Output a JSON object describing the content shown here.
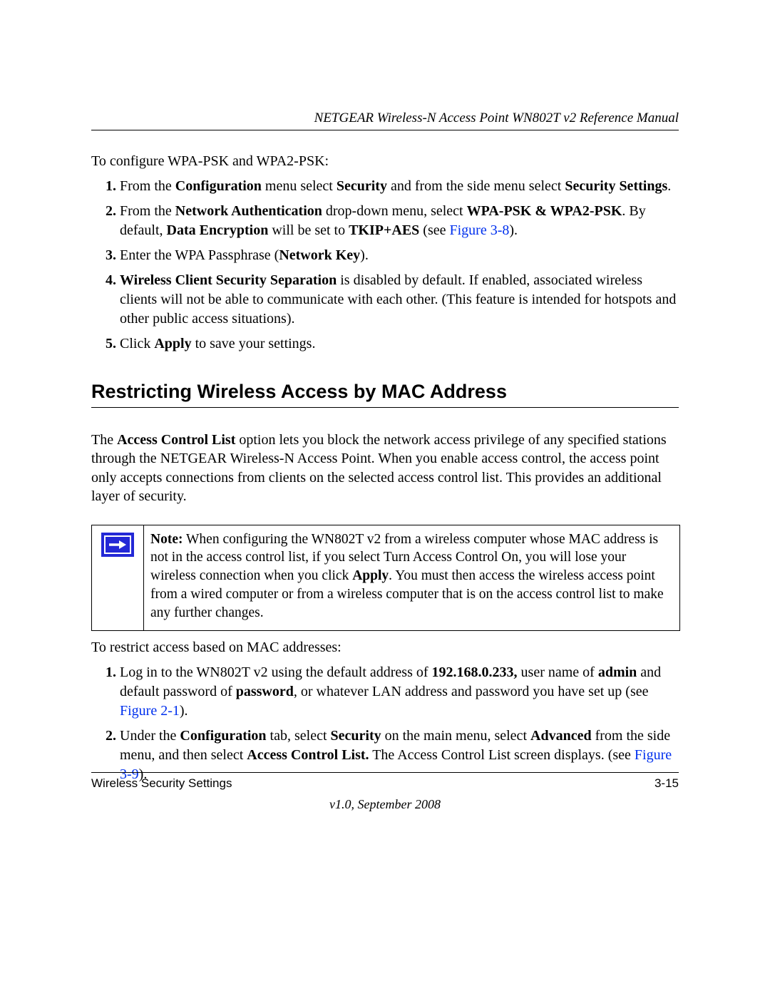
{
  "header": "NETGEAR Wireless-N Access Point WN802T v2 Reference Manual",
  "intro1": "To configure WPA-PSK and WPA2-PSK:",
  "steps1": {
    "s1_a": "From the ",
    "s1_b": "Configuration",
    "s1_c": " menu select ",
    "s1_d": "Security",
    "s1_e": " and from the side menu select ",
    "s1_f": "Security Settings",
    "s1_g": ".",
    "s2_a": "From the ",
    "s2_b": "Network Authentication",
    "s2_c": " drop-down menu, select ",
    "s2_d": "WPA-PSK & WPA2-PSK",
    "s2_e": ". By default, ",
    "s2_f": "Data Encryption",
    "s2_g": " will be set to ",
    "s2_h": "TKIP+AES",
    "s2_i": " (see ",
    "s2_link": "Figure 3-8",
    "s2_j": ").",
    "s3_a": "Enter the WPA Passphrase (",
    "s3_b": "Network Key",
    "s3_c": ").",
    "s4_a": "Wireless Client Security Separation",
    "s4_b": " is disabled by default. If enabled, associated wireless clients will not be able to communicate with each other. (This feature is intended for hotspots and other public access situations).",
    "s5_a": "Click ",
    "s5_b": "Apply",
    "s5_c": " to save your settings."
  },
  "section_heading": "Restricting Wireless Access by MAC Address",
  "para1_a": "The ",
  "para1_b": "Access Control List",
  "para1_c": " option lets you block the network access privilege of any specified stations through the NETGEAR Wireless-N Access Point. When you enable access control, the access point only accepts connections from clients on the selected access control list. This provides an additional layer of security.",
  "note_label": "Note:",
  "note_1": " When configuring the WN802T v2 from a wireless computer whose MAC address is not in the access control list, if you select Turn Access Control On, you will lose your wireless connection when you click ",
  "note_apply": "Apply",
  "note_2": ". You must then access the wireless access point from a wired computer or from a wireless computer that is on the access control list to make any further changes.",
  "intro2": "To restrict access based on MAC addresses:",
  "steps2": {
    "s1_a": "Log in to the WN802T v2 using the default address of ",
    "s1_b": "192.168.0.233,",
    "s1_c": " user name of ",
    "s1_d": "admin",
    "s1_e": " and default password of ",
    "s1_f": "password",
    "s1_g": ", or whatever LAN address and password you have set up (see ",
    "s1_link": "Figure 2-1",
    "s1_h": ").",
    "s2_a": "Under the ",
    "s2_b": "Configuration",
    "s2_c": " tab, select ",
    "s2_d": "Security",
    "s2_e": " on the main menu, select ",
    "s2_f": "Advanced",
    "s2_g": " from the side menu, and then select ",
    "s2_h": "Access Control List.",
    "s2_i": " The Access Control List screen displays. (see ",
    "s2_link": "Figure 3-9",
    "s2_j": ")."
  },
  "footer_left": "Wireless Security Settings",
  "footer_right": "3-15",
  "version": "v1.0, September 2008"
}
